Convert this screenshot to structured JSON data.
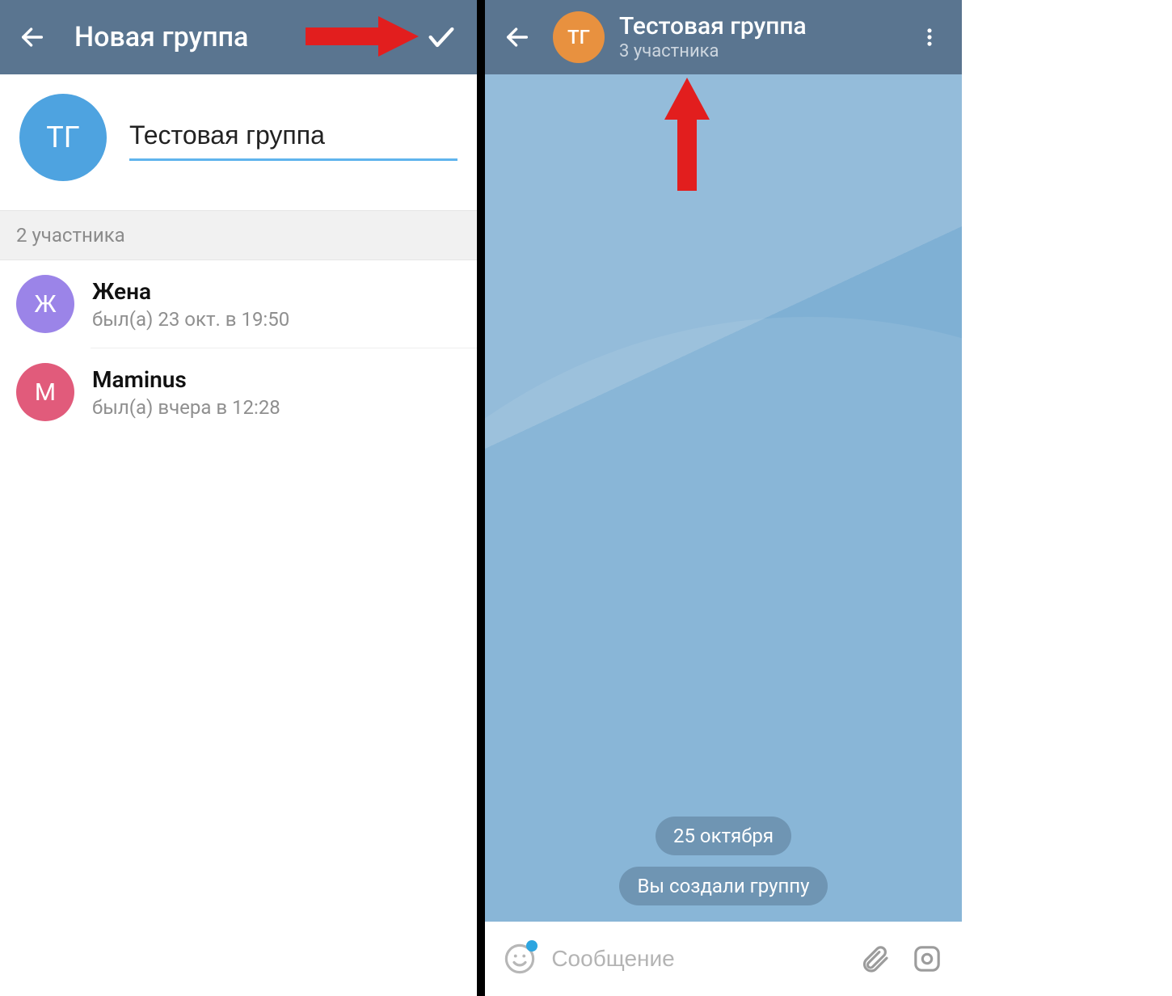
{
  "left": {
    "header": {
      "title": "Новая группа"
    },
    "group_avatar_initials": "ТГ",
    "group_name_value": "Тестовая группа",
    "members_header": "2 участника",
    "members": [
      {
        "initial": "Ж",
        "name": "Жена",
        "status": "был(а) 23 окт. в 19:50",
        "color": "#9b84e8"
      },
      {
        "initial": "М",
        "name": "Maminus",
        "status": "был(а) вчера в 12:28",
        "color": "#e15b7b"
      }
    ]
  },
  "right": {
    "header": {
      "avatar_initials": "ТГ",
      "title": "Тестовая группа",
      "subtitle": "3 участника"
    },
    "system_messages": [
      "25 октября",
      "Вы создали группу"
    ],
    "composer_placeholder": "Сообщение"
  }
}
